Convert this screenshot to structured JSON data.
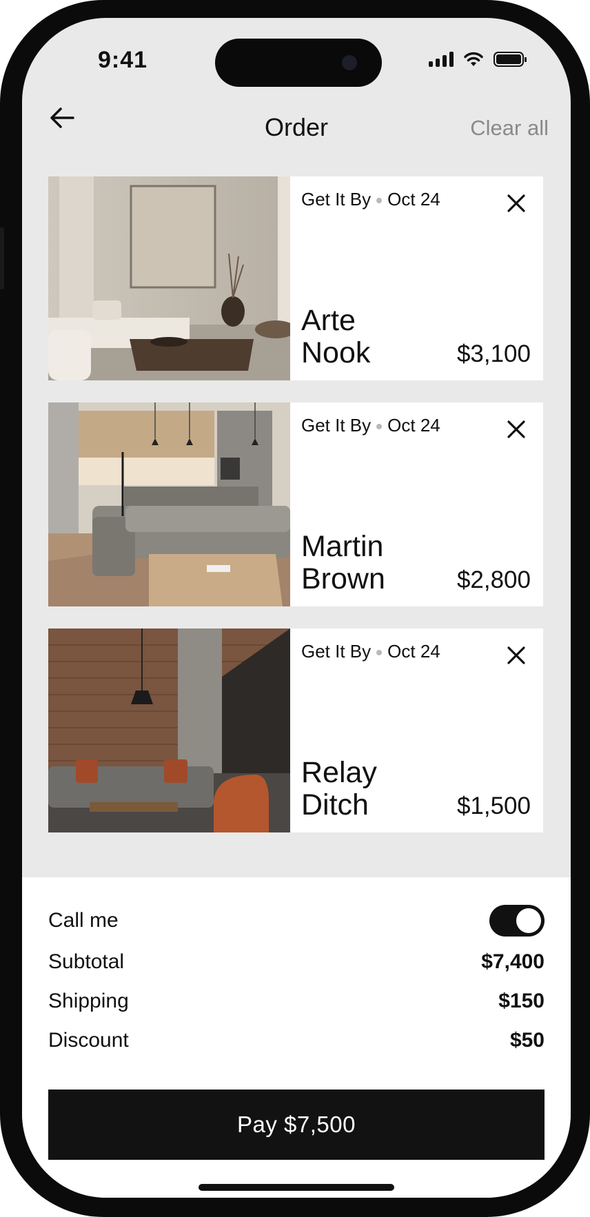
{
  "status_bar": {
    "time": "9:41"
  },
  "header": {
    "title": "Order",
    "clear_all": "Clear all"
  },
  "items": [
    {
      "get_it_by": "Get It By",
      "date": "Oct 24",
      "name": "Arte Nook",
      "price": "$3,100"
    },
    {
      "get_it_by": "Get It By",
      "date": "Oct 24",
      "name": "Martin Brown",
      "price": "$2,800"
    },
    {
      "get_it_by": "Get It By",
      "date": "Oct 24",
      "name": "Relay Ditch",
      "price": "$1,500"
    }
  ],
  "summary": {
    "call_me_label": "Call me",
    "call_me_on": true,
    "subtotal_label": "Subtotal",
    "subtotal": "$7,400",
    "shipping_label": "Shipping",
    "shipping": "$150",
    "discount_label": "Discount",
    "discount": "$50"
  },
  "pay_button": "Pay $7,500",
  "colors": {
    "accent": "#121212",
    "background": "#e9e9e9",
    "muted": "#8a8a8a"
  },
  "icons": [
    "back-arrow-icon",
    "close-icon",
    "signal-icon",
    "wifi-icon",
    "battery-icon"
  ]
}
